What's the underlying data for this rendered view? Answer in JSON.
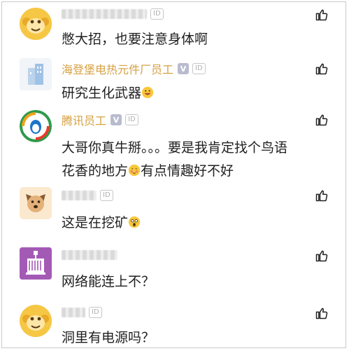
{
  "comments": [
    {
      "user": "",
      "id_badge": "ID",
      "text": "憋大招，也要注意身体啊",
      "avatar": "monkey-avatar-icon"
    },
    {
      "user": "海登堡电热元件厂员工",
      "id_badge": "ID",
      "text": "研究生化武器",
      "text_emoji": "grinning-emoji",
      "avatar": "buildings-avatar-icon"
    },
    {
      "user": "腾讯员工",
      "id_badge": "ID",
      "text_line1": "大哥你真牛掰。。。要是我肯定找个鸟语",
      "text_line2_a": "花香的地方",
      "text_line2_b": "有点情趣好不好",
      "text_emoji": "blushing-emoji",
      "avatar": "penguin-logo-avatar-icon"
    },
    {
      "user": "",
      "id_badge": "ID",
      "text": "这是在挖矿",
      "text_emoji": "shocked-emoji",
      "avatar": "dog-avatar-icon"
    },
    {
      "user": "",
      "id_badge": "ID",
      "text": "网络能连上不？",
      "avatar": "crate-avatar-icon"
    },
    {
      "user": "",
      "id_badge": "ID",
      "text": "洞里有电源吗？",
      "avatar": "monkey-avatar-icon"
    }
  ],
  "icons": {
    "like": "thumbs-up-icon",
    "verified": "verified-v-icon"
  },
  "colors": {
    "username": "#d5a143",
    "text": "#1f1f1f",
    "badge_bg": "#b9bccf"
  }
}
